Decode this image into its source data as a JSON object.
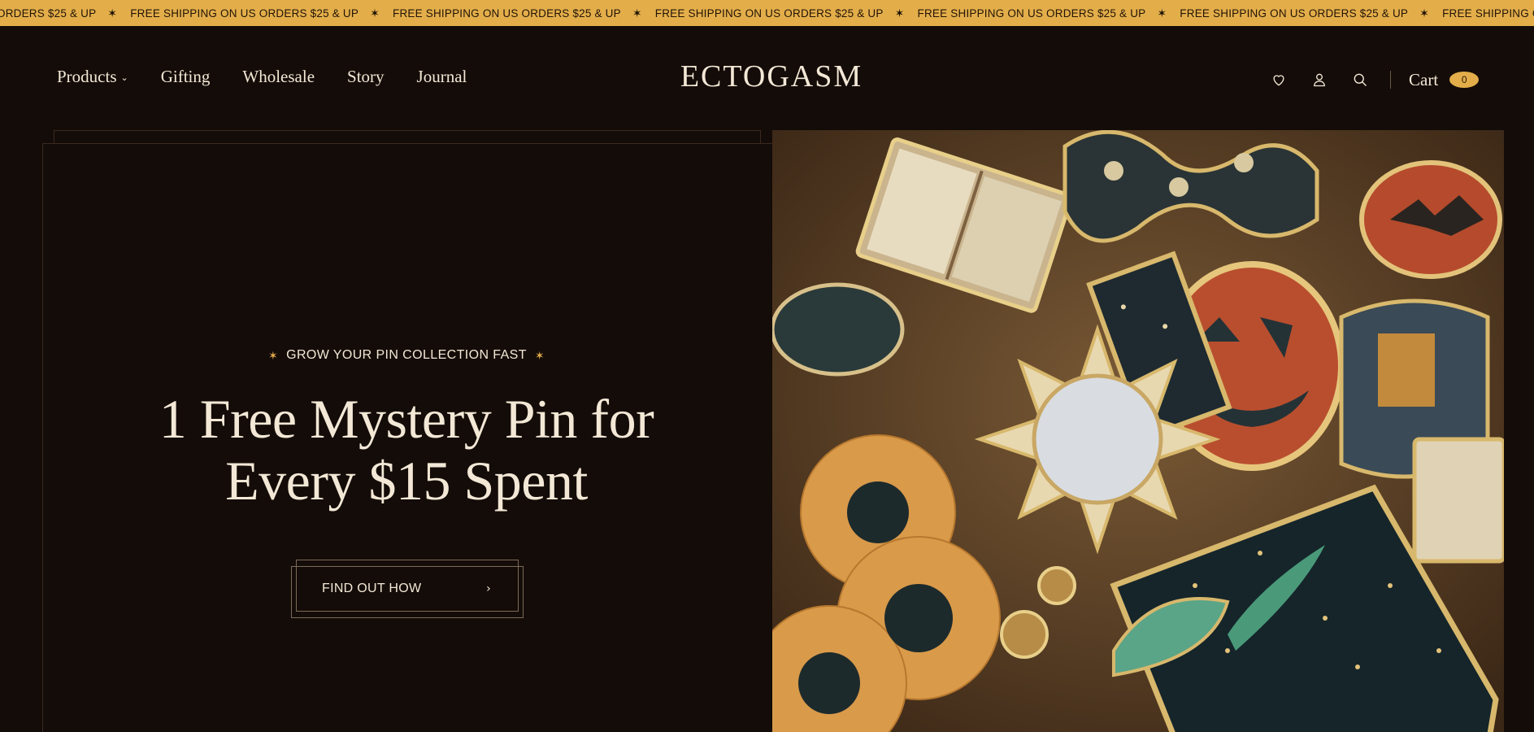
{
  "announcement": {
    "items": [
      "ORDERS $25 & UP",
      "FREE SHIPPING ON US ORDERS $25 & UP",
      "FREE SHIPPING ON US ORDERS $25 & UP",
      "FREE SHIPPING ON US ORDERS $25 & UP",
      "FREE SHIPPING ON US ORDERS $25 & UP",
      "FREE SHIPPING ON US ORDERS $25 & UP",
      "FREE SHIPPING ON US ORDERS $25 & UP",
      "F"
    ],
    "separator": "✶"
  },
  "header": {
    "nav": [
      "Products",
      "Gifting",
      "Wholesale",
      "Story",
      "Journal"
    ],
    "logo": "ECTOGASM",
    "cart_label": "Cart",
    "cart_count": "0"
  },
  "hero": {
    "eyebrow": "GROW YOUR PIN COLLECTION FAST",
    "star": "✶",
    "headline_line1": "1 Free Mystery Pin for",
    "headline_line2": "Every $15 Spent",
    "cta_label": "FIND OUT HOW",
    "cta_arrow": "›"
  },
  "colors": {
    "background": "#140c08",
    "accent": "#e3ae4a",
    "text": "#f3e8d6"
  }
}
